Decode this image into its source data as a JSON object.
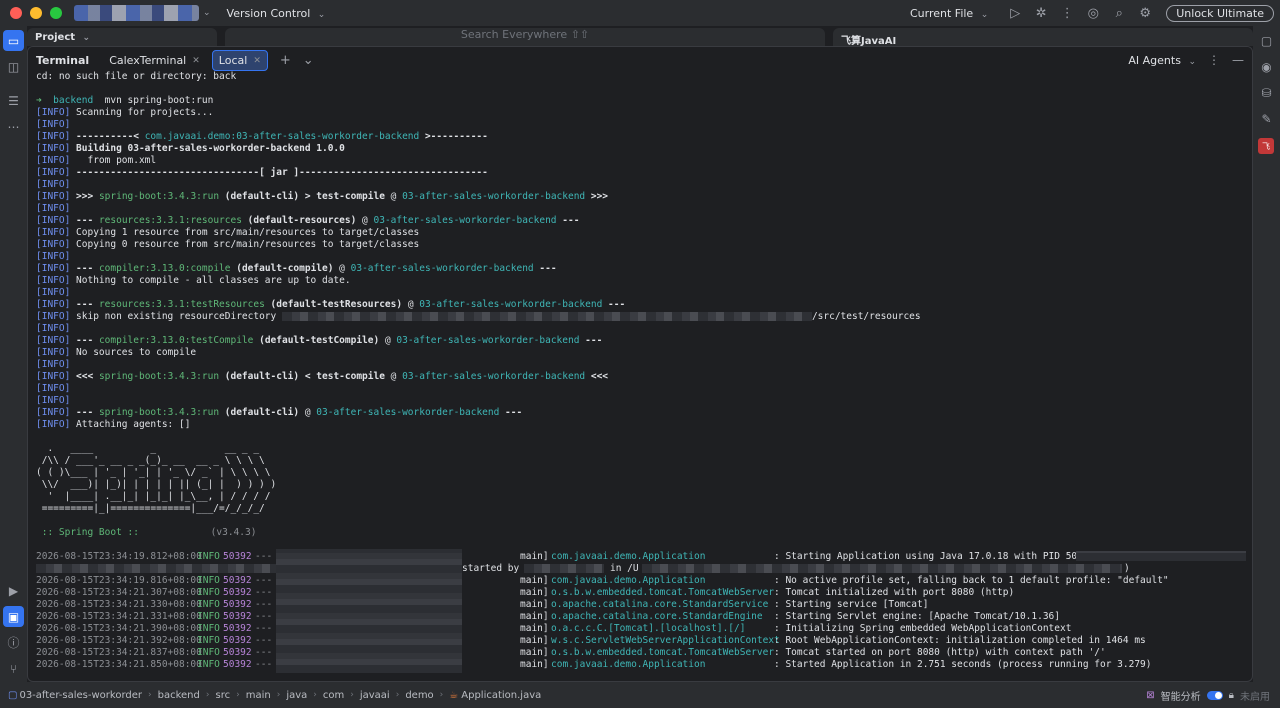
{
  "titlebar": {
    "vcs_label": "Version Control",
    "current_file_label": "Current File",
    "unlock_label": "Unlock Ultimate"
  },
  "top_panels": {
    "project_label": "Project",
    "search_placeholder": "Search Everywhere",
    "ai_label": "飞算JavaAI"
  },
  "terminal": {
    "title": "Terminal",
    "tabs": [
      {
        "label": "CalexTerminal"
      },
      {
        "label": "Local"
      }
    ],
    "ai_agents_label": "AI Agents",
    "lines": [
      {
        "s": [
          [
            "cd: no such file or directory: back",
            ""
          ]
        ]
      },
      {
        "s": [
          [
            "",
            ""
          ]
        ]
      },
      {
        "s": [
          [
            "➜ ",
            "prompt-arrow"
          ],
          [
            " backend ",
            "dir"
          ],
          [
            " mvn spring-boot:run",
            ""
          ]
        ]
      },
      {
        "s": [
          [
            "[INFO] ",
            "info"
          ],
          [
            "Scanning for projects...",
            ""
          ]
        ]
      },
      {
        "s": [
          [
            "[INFO] ",
            "info"
          ]
        ]
      },
      {
        "s": [
          [
            "[INFO] ",
            "info"
          ],
          [
            "----------< ",
            "b"
          ],
          [
            "com.javaai.demo:03-after-sales-workorder-backend",
            "c"
          ],
          [
            " >----------",
            "b"
          ]
        ]
      },
      {
        "s": [
          [
            "[INFO] ",
            "info"
          ],
          [
            "Building 03-after-sales-workorder-backend 1.0.0",
            "b"
          ]
        ]
      },
      {
        "s": [
          [
            "[INFO] ",
            "info"
          ],
          [
            "  from pom.xml",
            ""
          ]
        ]
      },
      {
        "s": [
          [
            "[INFO] ",
            "info"
          ],
          [
            "--------------------------------[ jar ]---------------------------------",
            "b"
          ]
        ]
      },
      {
        "s": [
          [
            "[INFO] ",
            "info"
          ]
        ]
      },
      {
        "s": [
          [
            "[INFO] ",
            "info"
          ],
          [
            ">>> ",
            "b"
          ],
          [
            "spring-boot:3.4.3:run",
            "g"
          ],
          [
            " (default-cli)",
            "b"
          ],
          [
            " > ",
            "b"
          ],
          [
            "test-compile",
            "b"
          ],
          [
            " @ ",
            ""
          ],
          [
            "03-after-sales-workorder-backend",
            "c"
          ],
          [
            " >>>",
            "b"
          ]
        ]
      },
      {
        "s": [
          [
            "[INFO] ",
            "info"
          ]
        ]
      },
      {
        "s": [
          [
            "[INFO] ",
            "info"
          ],
          [
            "--- ",
            "b"
          ],
          [
            "resources:3.3.1:resources",
            "g"
          ],
          [
            " (default-resources)",
            "b"
          ],
          [
            " @ ",
            ""
          ],
          [
            "03-after-sales-workorder-backend",
            "c"
          ],
          [
            " ---",
            "b"
          ]
        ]
      },
      {
        "s": [
          [
            "[INFO] ",
            "info"
          ],
          [
            "Copying 1 resource from src/main/resources to target/classes",
            ""
          ]
        ]
      },
      {
        "s": [
          [
            "[INFO] ",
            "info"
          ],
          [
            "Copying 0 resource from src/main/resources to target/classes",
            ""
          ]
        ]
      },
      {
        "s": [
          [
            "[INFO] ",
            "info"
          ]
        ]
      },
      {
        "s": [
          [
            "[INFO] ",
            "info"
          ],
          [
            "--- ",
            "b"
          ],
          [
            "compiler:3.13.0:compile",
            "g"
          ],
          [
            " (default-compile)",
            "b"
          ],
          [
            " @ ",
            ""
          ],
          [
            "03-after-sales-workorder-backend",
            "c"
          ],
          [
            " ---",
            "b"
          ]
        ]
      },
      {
        "s": [
          [
            "[INFO] ",
            "info"
          ],
          [
            "Nothing to compile - all classes are up to date.",
            ""
          ]
        ]
      },
      {
        "s": [
          [
            "[INFO] ",
            "info"
          ]
        ]
      },
      {
        "s": [
          [
            "[INFO] ",
            "info"
          ],
          [
            "--- ",
            "b"
          ],
          [
            "resources:3.3.1:testResources",
            "g"
          ],
          [
            " (default-testResources)",
            "b"
          ],
          [
            " @ ",
            ""
          ],
          [
            "03-after-sales-workorder-backend",
            "c"
          ],
          [
            " ---",
            "b"
          ]
        ]
      },
      {
        "s": [
          [
            "[INFO] ",
            "info"
          ],
          [
            "skip non existing resourceDirectory ",
            ""
          ],
          [
            "§blur530",
            ""
          ],
          [
            "/src/test/resources",
            ""
          ]
        ]
      },
      {
        "s": [
          [
            "[INFO] ",
            "info"
          ]
        ]
      },
      {
        "s": [
          [
            "[INFO] ",
            "info"
          ],
          [
            "--- ",
            "b"
          ],
          [
            "compiler:3.13.0:testCompile",
            "g"
          ],
          [
            " (default-testCompile)",
            "b"
          ],
          [
            " @ ",
            ""
          ],
          [
            "03-after-sales-workorder-backend",
            "c"
          ],
          [
            " ---",
            "b"
          ]
        ]
      },
      {
        "s": [
          [
            "[INFO] ",
            "info"
          ],
          [
            "No sources to compile",
            ""
          ]
        ]
      },
      {
        "s": [
          [
            "[INFO] ",
            "info"
          ]
        ]
      },
      {
        "s": [
          [
            "[INFO] ",
            "info"
          ],
          [
            "<<< ",
            "b"
          ],
          [
            "spring-boot:3.4.3:run",
            "g"
          ],
          [
            " (default-cli)",
            "b"
          ],
          [
            " < ",
            "b"
          ],
          [
            "test-compile",
            "b"
          ],
          [
            " @ ",
            ""
          ],
          [
            "03-after-sales-workorder-backend",
            "c"
          ],
          [
            " <<<",
            "b"
          ]
        ]
      },
      {
        "s": [
          [
            "[INFO] ",
            "info"
          ]
        ]
      },
      {
        "s": [
          [
            "[INFO] ",
            "info"
          ]
        ]
      },
      {
        "s": [
          [
            "[INFO] ",
            "info"
          ],
          [
            "--- ",
            "b"
          ],
          [
            "spring-boot:3.4.3:run",
            "g"
          ],
          [
            " (default-cli)",
            "b"
          ],
          [
            " @ ",
            ""
          ],
          [
            "03-after-sales-workorder-backend",
            "c"
          ],
          [
            " ---",
            "b"
          ]
        ]
      },
      {
        "s": [
          [
            "[INFO] ",
            "info"
          ],
          [
            "Attaching agents: []",
            ""
          ]
        ]
      }
    ],
    "banner": [
      "  .   ____          _            __ _ _",
      " /\\\\ / ___'_ __ _ _(_)_ __  __ _ \\ \\ \\ \\",
      "( ( )\\___ | '_ | '_| | '_ \\/ _` | \\ \\ \\ \\",
      " \\\\/  ___)| |_)| | | | | || (_| |  ) ) ) )",
      "  '  |____| .__|_| |_|_| |_\\__, | / / / /",
      " =========|_|==============|___/=/_/_/_/"
    ],
    "spring_boot_label": " :: Spring Boot :: ",
    "spring_boot_version": "(v3.4.3)",
    "logs": [
      {
        "time": "2026-08-15T23:34:19.812+08:00",
        "level": "INFO",
        "pid": "50392",
        "thread": "main]",
        "logger": "com.javaai.demo.Application",
        "msg": ": Starting Application using Java 17.0.18 with PID 50392 ("
      },
      {
        "time": "",
        "level": "",
        "pid": "",
        "thread": "",
        "logger": "",
        "msg": "",
        "extra": "started by",
        "extra2": "in /U",
        "tail": ")"
      },
      {
        "time": "2026-08-15T23:34:19.816+08:00",
        "level": "INFO",
        "pid": "50392",
        "thread": "main]",
        "logger": "com.javaai.demo.Application",
        "msg": ": No active profile set, falling back to 1 default profile: \"default\""
      },
      {
        "time": "2026-08-15T23:34:21.307+08:00",
        "level": "INFO",
        "pid": "50392",
        "thread": "main]",
        "logger": "o.s.b.w.embedded.tomcat.TomcatWebServer",
        "msg": ": Tomcat initialized with port 8080 (http)"
      },
      {
        "time": "2026-08-15T23:34:21.330+08:00",
        "level": "INFO",
        "pid": "50392",
        "thread": "main]",
        "logger": "o.apache.catalina.core.StandardService",
        "msg": ": Starting service [Tomcat]"
      },
      {
        "time": "2026-08-15T23:34:21.331+08:00",
        "level": "INFO",
        "pid": "50392",
        "thread": "main]",
        "logger": "o.apache.catalina.core.StandardEngine",
        "msg": ": Starting Servlet engine: [Apache Tomcat/10.1.36]"
      },
      {
        "time": "2026-08-15T23:34:21.390+08:00",
        "level": "INFO",
        "pid": "50392",
        "thread": "main]",
        "logger": "o.a.c.c.C.[Tomcat].[localhost].[/]",
        "msg": ": Initializing Spring embedded WebApplicationContext"
      },
      {
        "time": "2026-08-15T23:34:21.392+08:00",
        "level": "INFO",
        "pid": "50392",
        "thread": "main]",
        "logger": "w.s.c.ServletWebServerApplicationContext",
        "msg": ": Root WebApplicationContext: initialization completed in 1464 ms"
      },
      {
        "time": "2026-08-15T23:34:21.837+08:00",
        "level": "INFO",
        "pid": "50392",
        "thread": "main]",
        "logger": "o.s.b.w.embedded.tomcat.TomcatWebServer",
        "msg": ": Tomcat started on port 8080 (http) with context path '/'"
      },
      {
        "time": "2026-08-15T23:34:21.850+08:00",
        "level": "INFO",
        "pid": "50392",
        "thread": "main]",
        "logger": "com.javaai.demo.Application",
        "msg": ": Started Application in 2.751 seconds (process running for 3.279)"
      }
    ],
    "log_dash": "---"
  },
  "statusbar": {
    "crumbs": [
      "03-after-sales-workorder",
      "backend",
      "src",
      "main",
      "java",
      "com",
      "javaai",
      "demo",
      "Application.java"
    ],
    "smart_label": "智能分析",
    "disabled_label": "未启用"
  },
  "colors": {
    "accent": "#3574f0",
    "info": "#6f8ff0",
    "green": "#5fb878",
    "cyan": "#3fb6b6",
    "pid": "#b784d8"
  }
}
